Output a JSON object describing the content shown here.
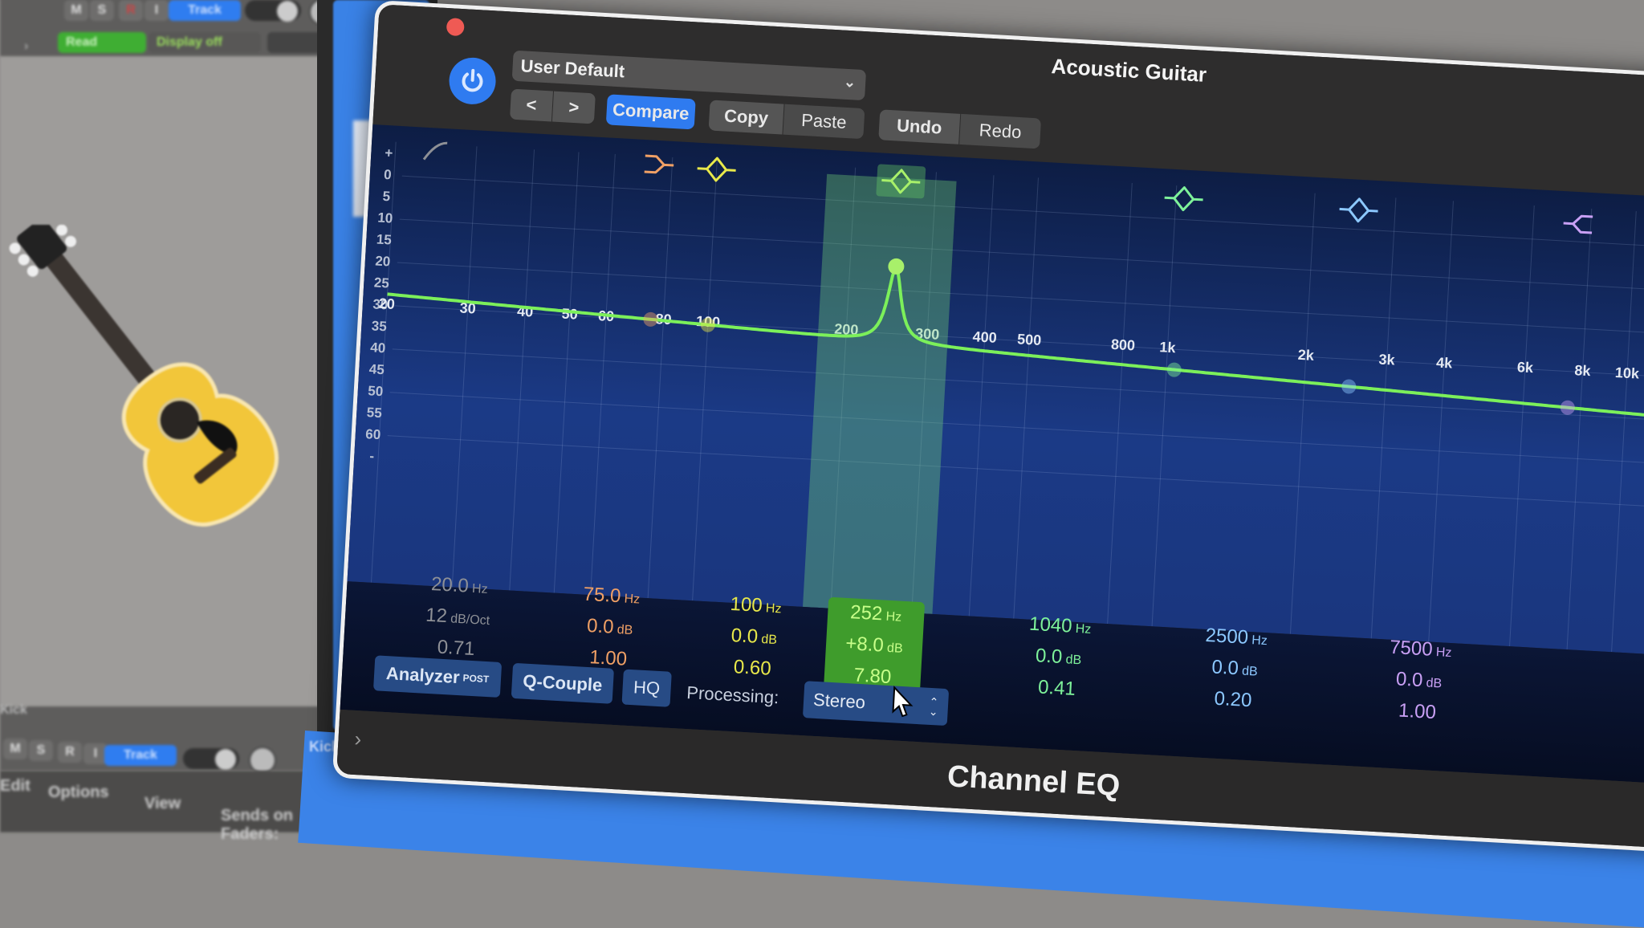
{
  "daw": {
    "top_track": {
      "buttons": [
        "M",
        "S",
        "R",
        "I"
      ],
      "track_button": "Track",
      "automation_mode": "Read",
      "display_mode": "Display off"
    },
    "bottom_track": {
      "name": "Kick",
      "buttons": [
        "M",
        "S",
        "R",
        "I"
      ],
      "track_button": "Track"
    },
    "region_label": "Kick",
    "footer_menu": [
      "Edit",
      "Options",
      "View",
      "Sends on Faders:"
    ]
  },
  "plugin": {
    "window_title": "Acoustic Guitar",
    "plugin_name": "Channel EQ",
    "preset": "User Default",
    "toolbar": {
      "prev_label": "<",
      "next_label": ">",
      "compare_label": "Compare",
      "copy_label": "Copy",
      "paste_label": "Paste",
      "undo_label": "Undo",
      "redo_label": "Redo"
    },
    "db_scale": [
      "+",
      "0",
      "5",
      "10",
      "15",
      "20",
      "25",
      "30",
      "35",
      "40",
      "45",
      "50",
      "55",
      "60",
      "-"
    ],
    "freq_scale": [
      "20",
      "30",
      "40",
      "50",
      "60",
      "80",
      "100",
      "200",
      "300",
      "400",
      "500",
      "800",
      "1k",
      "2k",
      "3k",
      "4k",
      "6k",
      "8k",
      "10k"
    ],
    "bands": [
      {
        "name": "Low Cut",
        "icon": "low-cut-icon",
        "color": "#8e9096",
        "freq": "20.0",
        "freq_unit": "Hz",
        "gain": "12",
        "gain_unit": "dB/Oct",
        "q": "0.71",
        "selected": false
      },
      {
        "name": "Low Shelf",
        "icon": "low-shelf-icon",
        "color": "#f0a065",
        "freq": "75.0",
        "freq_unit": "Hz",
        "gain": "0.0",
        "gain_unit": "dB",
        "q": "1.00",
        "selected": false
      },
      {
        "name": "Bell 1",
        "icon": "bell-icon",
        "color": "#e8e84a",
        "freq": "100",
        "freq_unit": "Hz",
        "gain": "0.0",
        "gain_unit": "dB",
        "q": "0.60",
        "selected": false
      },
      {
        "name": "Bell 2",
        "icon": "bell-icon",
        "color": "#a8f06a",
        "freq": "252",
        "freq_unit": "Hz",
        "gain": "+8.0",
        "gain_unit": "dB",
        "q": "7.80",
        "selected": true
      },
      {
        "name": "Bell 3",
        "icon": "bell-icon",
        "color": "#7ef29a",
        "freq": "1040",
        "freq_unit": "Hz",
        "gain": "0.0",
        "gain_unit": "dB",
        "q": "0.41",
        "selected": false
      },
      {
        "name": "Bell 4",
        "icon": "bell-icon",
        "color": "#8cc8ff",
        "freq": "2500",
        "freq_unit": "Hz",
        "gain": "0.0",
        "gain_unit": "dB",
        "q": "0.20",
        "selected": false
      },
      {
        "name": "High Shelf",
        "icon": "high-shelf-icon",
        "color": "#c9a0f5",
        "freq": "7500",
        "freq_unit": "Hz",
        "gain": "0.0",
        "gain_unit": "dB",
        "q": "1.00",
        "selected": false
      }
    ],
    "options": {
      "analyzer_label": "Analyzer",
      "analyzer_mode": "POST",
      "q_couple_label": "Q-Couple",
      "hq_label": "HQ",
      "processing_label": "Processing:",
      "processing_value": "Stereo"
    },
    "colors": {
      "accent": "#2f7bf0",
      "curve": "#7cf05a",
      "selected_band_bg": "#3f9c2c"
    }
  }
}
